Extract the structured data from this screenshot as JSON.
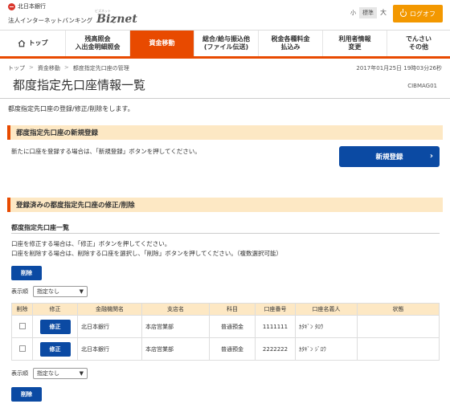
{
  "header": {
    "bank_name": "北日本銀行",
    "product_jp": "法人インターネットバンキング",
    "product_brand": "Biznet",
    "product_ruby": "ビズネット",
    "font_size_options": [
      "小",
      "標準",
      "大"
    ],
    "font_size_selected": "標準",
    "logout_label": "ログオフ"
  },
  "nav": {
    "home": "トップ",
    "items": [
      {
        "line1": "残高照会",
        "line2": "入出金明細照会"
      },
      {
        "line1": "資金移動",
        "line2": ""
      },
      {
        "line1": "総合/給与振込他",
        "line2": "(ファイル伝送)"
      },
      {
        "line1": "税金各種料金",
        "line2": "払込み"
      },
      {
        "line1": "利用者情報",
        "line2": "変更"
      },
      {
        "line1": "でんさい",
        "line2": "その他"
      }
    ],
    "active_index": 1
  },
  "breadcrumb": [
    "トップ",
    "資金移動",
    "都度指定先口座の管理"
  ],
  "breadcrumb_sep": ">",
  "timestamp": "2017年01月25日 19時03分26秒",
  "page_title": "都度指定先口座情報一覧",
  "screen_id": "CIBMAG01",
  "description": "都度指定先口座の登録/修正/削除をします。",
  "new_section": {
    "heading": "都度指定先口座の新規登録",
    "text": "新たに口座を登録する場合は、「新規登録」ボタンを押してください。",
    "button": "新規登録",
    "chevron": "›"
  },
  "edit_section": {
    "heading": "登録済みの都度指定先口座の修正/削除",
    "list_heading": "都度指定先口座一覧",
    "instr1": "口座を修正する場合は、「修正」ボタンを押してください。",
    "instr2": "口座を削除する場合は、削除する口座を選択し、「削除」ボタンを押してください。（複数選択可能）",
    "delete_button": "削除",
    "sort_label": "表示順",
    "sort_value": "指定なし",
    "sort_caret": "▼",
    "columns": [
      "削除",
      "修正",
      "金融機関名",
      "支店名",
      "科目",
      "口座番号",
      "口座名義人",
      "状態"
    ],
    "rows": [
      {
        "edit": "修正",
        "bank": "北日本銀行",
        "branch": "本店営業部",
        "type": "普通預金",
        "account": "1111111",
        "holder": "ｶﾀｷﾞﾝ ﾀﾛｳ",
        "status": ""
      },
      {
        "edit": "修正",
        "bank": "北日本銀行",
        "branch": "本店営業部",
        "type": "普通預金",
        "account": "2222222",
        "holder": "ｶﾀｷﾞﾝ ｼﾞﾛｳ",
        "status": ""
      }
    ]
  },
  "colors": {
    "accent": "#e84a00",
    "logout": "#f39800",
    "button_blue": "#0b4aa3",
    "section_bg": "#fde8c4"
  }
}
